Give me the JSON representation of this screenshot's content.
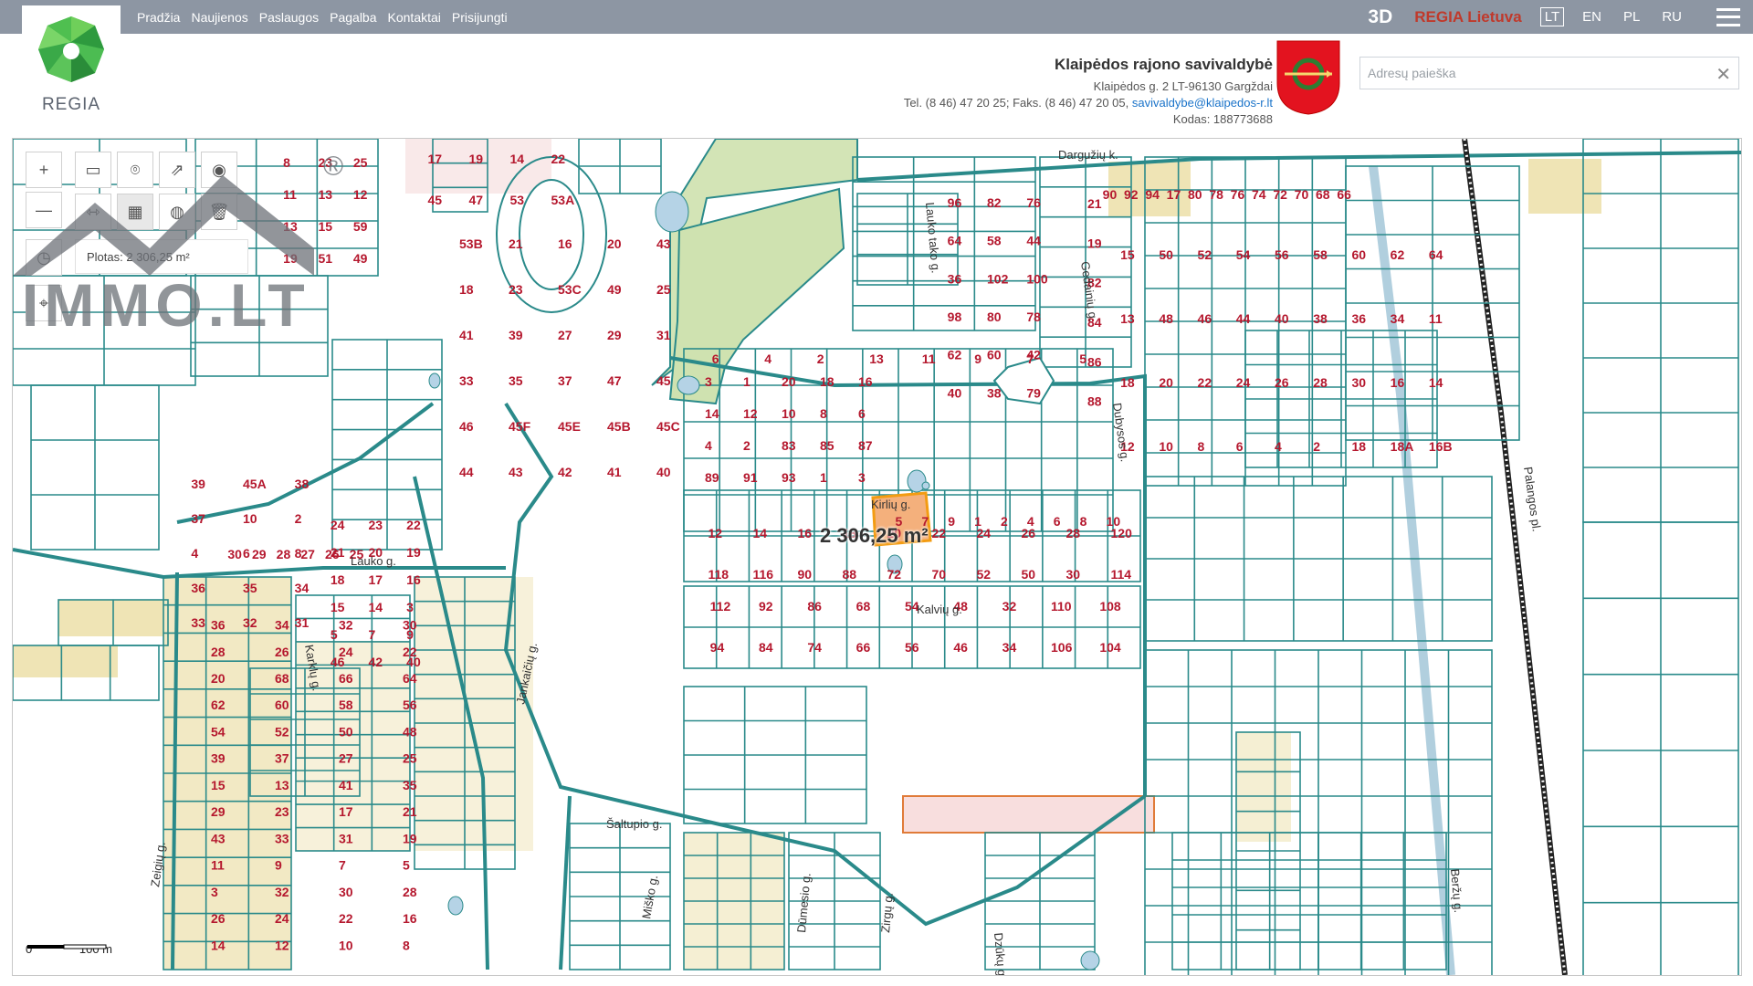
{
  "nav": {
    "items": [
      "Pradžia",
      "Naujienos",
      "Paslaugos",
      "Pagalba",
      "Kontaktai",
      "Prisijungti"
    ],
    "btn_3d": "3D",
    "brand": "REGIA Lietuva",
    "languages": [
      "LT",
      "EN",
      "PL",
      "RU"
    ],
    "active_language": "LT"
  },
  "logo": {
    "text": "REGIA"
  },
  "municipality": {
    "name": "Klaipėdos rajono savivaldybė",
    "address": "Klaipėdos g. 2 LT-96130 Gargždai",
    "phone": "Tel. (8 46) 47 20 25; Faks. (8 46) 47 20 05,",
    "email": "savivaldybe@klaipedos-r.lt",
    "code": "Kodas: 188773688"
  },
  "search": {
    "placeholder": "Adresų paieška",
    "clear_icon": "close-icon"
  },
  "tools": {
    "zoom_in": "+",
    "zoom_out": "—",
    "area_label": "Plotas: 2 306,25 m²"
  },
  "map": {
    "measurement": "2 306,25 m²",
    "scale": {
      "left": "0",
      "right": "100 m"
    },
    "streets": [
      "Dargužių k.",
      "Kirlių g.",
      "Kalvių g.",
      "Lauko g.",
      "Šaltupio g.",
      "Jankaičių g.",
      "Karklų g.",
      "Zeigių g.",
      "Gedainių g.",
      "Dubysos g.",
      "Miško g.",
      "Dūmesio g.",
      "Zirgų g.",
      "Palangos pl.",
      "Beržų g.",
      "Dzūkų g.",
      "Lauko tako g."
    ],
    "parcel_numbers": [
      "8",
      "23",
      "25",
      "11",
      "13",
      "12",
      "13",
      "15",
      "59",
      "19",
      "51",
      "49",
      "17",
      "19",
      "14",
      "22",
      "45",
      "47",
      "53",
      "53A",
      "53B",
      "21",
      "16",
      "20",
      "43",
      "18",
      "23",
      "53C",
      "49",
      "25",
      "41",
      "39",
      "27",
      "29",
      "31",
      "33",
      "35",
      "37",
      "47",
      "45",
      "46",
      "45F",
      "45E",
      "45B",
      "45C",
      "44",
      "43",
      "42",
      "41",
      "40",
      "39",
      "45A",
      "38",
      "37",
      "10",
      "2",
      "4",
      "6",
      "8",
      "36",
      "35",
      "34",
      "33",
      "32",
      "31",
      "30",
      "29",
      "28",
      "27",
      "26",
      "25",
      "24",
      "23",
      "22",
      "21",
      "20",
      "19",
      "18",
      "17",
      "16",
      "15",
      "14",
      "3",
      "5",
      "7",
      "9",
      "46",
      "42",
      "40",
      "36",
      "34",
      "32",
      "30",
      "28",
      "26",
      "24",
      "22",
      "20",
      "68",
      "66",
      "64",
      "62",
      "60",
      "58",
      "56",
      "54",
      "52",
      "50",
      "48",
      "39",
      "37",
      "27",
      "25",
      "15",
      "13",
      "41",
      "35",
      "29",
      "23",
      "17",
      "21",
      "43",
      "33",
      "31",
      "19",
      "11",
      "9",
      "7",
      "5",
      "3",
      "32",
      "30",
      "28",
      "26",
      "24",
      "22",
      "16",
      "14",
      "12",
      "10",
      "8",
      "6",
      "4",
      "2",
      "13",
      "11",
      "9",
      "7",
      "5",
      "3",
      "1",
      "20",
      "18",
      "16",
      "14",
      "12",
      "10",
      "8",
      "6",
      "4",
      "2",
      "83",
      "85",
      "87",
      "89",
      "91",
      "93",
      "1",
      "3",
      "5",
      "7",
      "9",
      "1",
      "2",
      "4",
      "6",
      "8",
      "10",
      "12",
      "14",
      "16",
      "18",
      "20",
      "22",
      "24",
      "26",
      "28",
      "120",
      "118",
      "116",
      "90",
      "88",
      "72",
      "70",
      "52",
      "50",
      "30",
      "114",
      "112",
      "92",
      "86",
      "68",
      "54",
      "48",
      "32",
      "110",
      "108",
      "94",
      "84",
      "74",
      "66",
      "56",
      "46",
      "34",
      "106",
      "104",
      "96",
      "82",
      "76",
      "64",
      "58",
      "44",
      "36",
      "102",
      "100",
      "98",
      "80",
      "78",
      "62",
      "60",
      "42",
      "40",
      "38",
      "79",
      "21",
      "19",
      "82",
      "84",
      "86",
      "88",
      "90",
      "92",
      "94",
      "17",
      "80",
      "78",
      "76",
      "74",
      "72",
      "70",
      "68",
      "66",
      "15",
      "50",
      "52",
      "54",
      "56",
      "58",
      "60",
      "62",
      "64",
      "13",
      "48",
      "46",
      "44",
      "40",
      "38",
      "36",
      "34",
      "11",
      "18",
      "20",
      "22",
      "24",
      "26",
      "28",
      "30",
      "16",
      "14",
      "12",
      "10",
      "8",
      "6",
      "4",
      "2",
      "18",
      "18A",
      "16B"
    ]
  },
  "watermark": {
    "text": "IMMO.LT",
    "registered": "®"
  },
  "colors": {
    "topbar": "#8d96a3",
    "brand_red": "#c0392b",
    "parcel_line": "#2a8a8a",
    "parcel_label": "#b5182e",
    "residential_fill": "#efe4b5",
    "green_area": "#d3e4b6",
    "highlight": "#f4b07c"
  }
}
